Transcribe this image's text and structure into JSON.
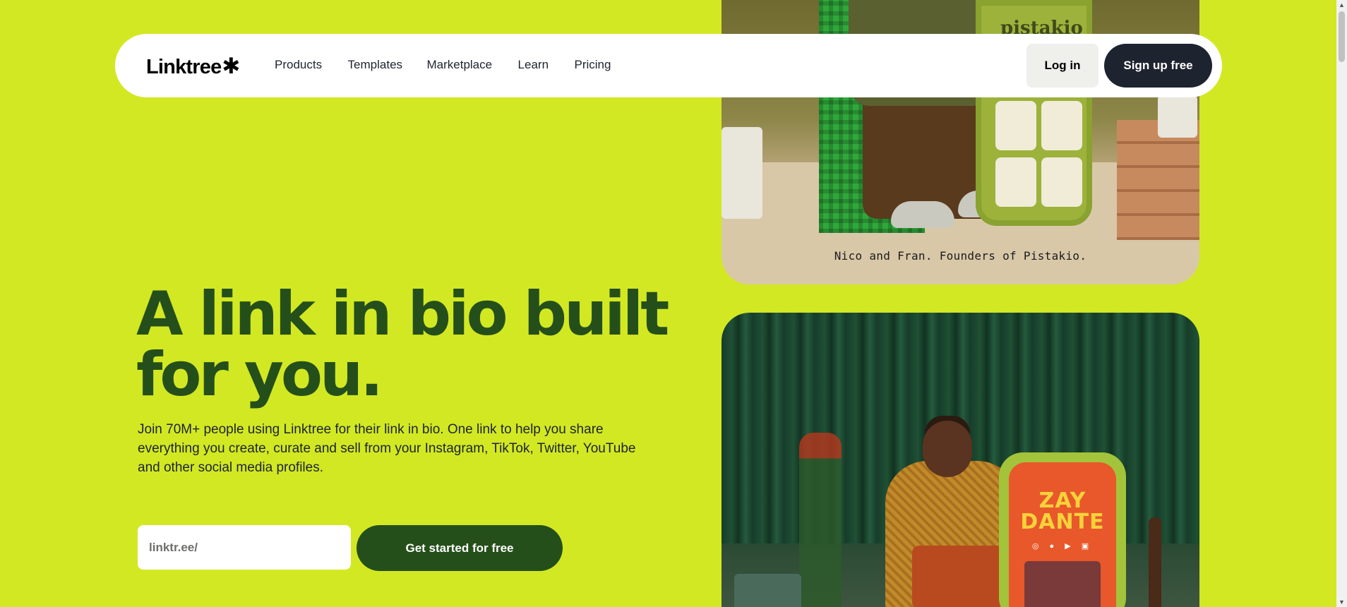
{
  "nav": {
    "logo_text": "Linktree",
    "logo_mark": "✱",
    "links": [
      "Products",
      "Templates",
      "Marketplace",
      "Learn",
      "Pricing"
    ],
    "login_label": "Log in",
    "signup_label": "Sign up free"
  },
  "hero": {
    "title_line1": "A link in bio built",
    "title_line2": "for you.",
    "subtitle": "Join 70M+ people using Linktree for their link in bio. One link to help you share everything you create, curate and sell from your Instagram, TikTok, Twitter, YouTube and other social media profiles.",
    "input_placeholder": "linktr.ee/",
    "cta_label": "Get started for free"
  },
  "gallery": {
    "top_caption": "Nico and Fran. Founders of Pistakio.",
    "top_brand_text": "pistakio",
    "bottom_phone_title_line1": "ZAY",
    "bottom_phone_title_line2": "DANTE",
    "bottom_phone_icons": "◎ ● ▶ ▣"
  },
  "colors": {
    "background": "#d2e823",
    "hero_title": "#254f1a",
    "cta_button": "#254f1a",
    "signup_button": "#1e2330",
    "login_button": "#eff0ec"
  },
  "scrollbar": {
    "up_arrow": "▲",
    "down_arrow": "▼"
  }
}
